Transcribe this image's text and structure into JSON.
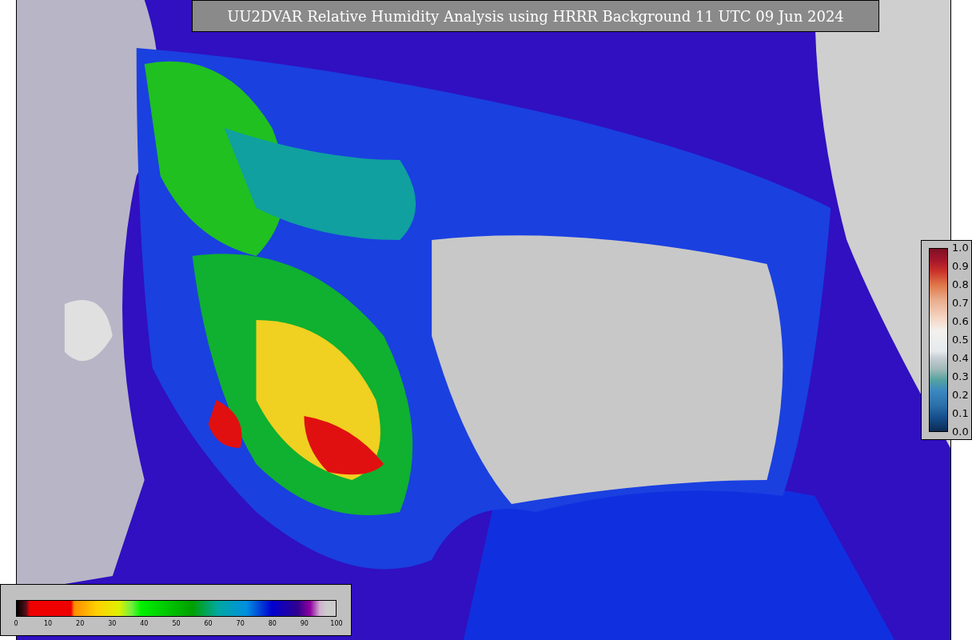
{
  "title": "UU2DVAR Relative Humidity Analysis using HRRR Background 11 UTC 09 Jun 2024",
  "side_colorbar": {
    "ticks": [
      "1.0",
      "0.9",
      "0.8",
      "0.7",
      "0.6",
      "0.5",
      "0.4",
      "0.3",
      "0.2",
      "0.1",
      "0.0"
    ]
  },
  "bottom_colorbar": {
    "ticks": [
      "0",
      "10",
      "20",
      "30",
      "40",
      "50",
      "60",
      "70",
      "80",
      "90",
      "100"
    ]
  }
}
